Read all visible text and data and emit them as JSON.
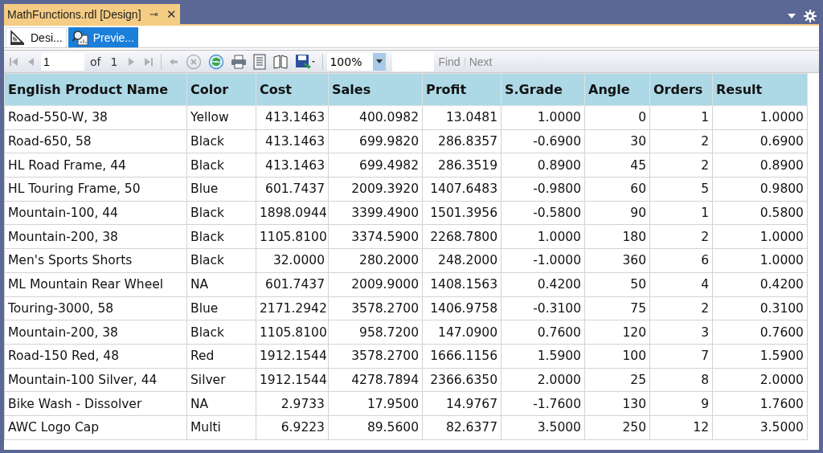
{
  "document_tab": {
    "title": "MathFunctions.rdl [Design]",
    "pin": "⊸",
    "close": "✕"
  },
  "view_tabs": [
    {
      "label": "Desi...",
      "kind": "design",
      "selected": false
    },
    {
      "label": "Previe...",
      "kind": "preview",
      "selected": true
    }
  ],
  "toolbar": {
    "nav_buttons": [
      {
        "kind": "first",
        "disabled": true
      },
      {
        "kind": "previous",
        "disabled": true
      }
    ],
    "page": "1",
    "of_label": "of",
    "total_pages": "1",
    "nav_buttons_after": [
      {
        "kind": "next",
        "disabled": true
      },
      {
        "kind": "last",
        "disabled": true
      }
    ],
    "tools": [
      {
        "kind": "back",
        "disabled": true
      },
      {
        "kind": "stop",
        "disabled": true
      },
      {
        "kind": "refresh",
        "disabled": false
      },
      {
        "kind": "print",
        "disabled": false
      },
      {
        "kind": "layout",
        "disabled": false
      },
      {
        "kind": "page-setup",
        "disabled": false
      },
      {
        "kind": "export",
        "disabled": false
      }
    ],
    "zoom": "100%",
    "find_label": "Find",
    "next_label": "Next"
  },
  "table": {
    "columns": [
      {
        "label": "English Product Name",
        "kind": "text"
      },
      {
        "label": "Color",
        "kind": "text"
      },
      {
        "label": "Cost",
        "kind": "number"
      },
      {
        "label": "Sales",
        "kind": "number"
      },
      {
        "label": "Profit",
        "kind": "number"
      },
      {
        "label": "S.Grade",
        "kind": "number"
      },
      {
        "label": "Angle",
        "kind": "number"
      },
      {
        "label": "Orders",
        "kind": "number"
      },
      {
        "label": "Result",
        "kind": "number"
      }
    ],
    "rows": [
      [
        "Road-550-W, 38",
        "Yellow",
        "413.1463",
        "400.0982",
        "13.0481",
        "1.0000",
        "0",
        "1",
        "1.0000"
      ],
      [
        "Road-650, 58",
        "Black",
        "413.1463",
        "699.9820",
        "286.8357",
        "-0.6900",
        "30",
        "2",
        "0.6900"
      ],
      [
        "HL Road Frame, 44",
        "Black",
        "413.1463",
        "699.4982",
        "286.3519",
        "0.8900",
        "45",
        "2",
        "0.8900"
      ],
      [
        "HL Touring Frame, 50",
        "Blue",
        "601.7437",
        "2009.3920",
        "1407.6483",
        "-0.9800",
        "60",
        "5",
        "0.9800"
      ],
      [
        "Mountain-100, 44",
        "Black",
        "1898.0944",
        "3399.4900",
        "1501.3956",
        "-0.5800",
        "90",
        "1",
        "0.5800"
      ],
      [
        "Mountain-200, 38",
        "Black",
        "1105.8100",
        "3374.5900",
        "2268.7800",
        "1.0000",
        "180",
        "2",
        "1.0000"
      ],
      [
        "Men's Sports Shorts",
        "Black",
        "32.0000",
        "280.2000",
        "248.2000",
        "-1.0000",
        "360",
        "6",
        "1.0000"
      ],
      [
        "ML Mountain Rear Wheel",
        "NA",
        "601.7437",
        "2009.9000",
        "1408.1563",
        "0.4200",
        "50",
        "4",
        "0.4200"
      ],
      [
        "Touring-3000, 58",
        "Blue",
        "2171.2942",
        "3578.2700",
        "1406.9758",
        "-0.3100",
        "75",
        "2",
        "0.3100"
      ],
      [
        "Mountain-200, 38",
        "Black",
        "1105.8100",
        "958.7200",
        "147.0900",
        "0.7600",
        "120",
        "3",
        "0.7600"
      ],
      [
        "Road-150 Red, 48",
        "Red",
        "1912.1544",
        "3578.2700",
        "1666.1156",
        "1.5900",
        "100",
        "7",
        "1.5900"
      ],
      [
        "Mountain-100 Silver, 44",
        "Silver",
        "1912.1544",
        "4278.7894",
        "2366.6350",
        "2.0000",
        "25",
        "8",
        "2.0000"
      ],
      [
        "Bike Wash - Dissolver",
        "NA",
        "2.9733",
        "17.9500",
        "14.9767",
        "-1.7600",
        "130",
        "9",
        "1.7600"
      ],
      [
        "AWC Logo Cap",
        "Multi",
        "6.9223",
        "89.5600",
        "82.6377",
        "3.5000",
        "250",
        "12",
        "3.5000"
      ]
    ]
  }
}
